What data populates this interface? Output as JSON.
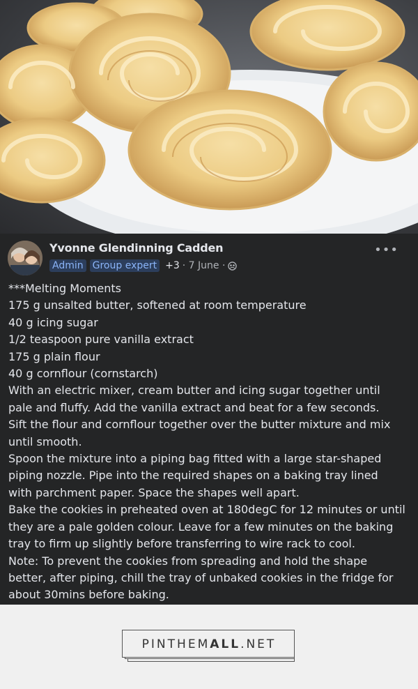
{
  "post": {
    "author": "Yvonne Glendinning Cadden",
    "badges": [
      "Admin",
      "Group expert"
    ],
    "extra_badges": "+3",
    "date": "· 7 June ·",
    "more_label": "•••",
    "icons": {
      "privacy": "group-globe-icon",
      "more": "more-options-icon"
    },
    "lines": [
      "***Melting Moments",
      "175 g unsalted butter, softened at room temperature",
      "40 g icing sugar",
      "1/2 teaspoon pure vanilla extract",
      "175 g plain flour",
      "40 g cornflour (cornstarch)",
      "With an electric mixer, cream butter and icing sugar together until",
      "pale and fluffy. Add the vanilla extract and beat for a few seconds.",
      "Sift the flour and cornflour together over the butter mixture and mix",
      "until smooth.",
      "Spoon the mixture into a piping bag fitted with a large star-shaped",
      "piping nozzle. Pipe into the required shapes on a baking tray lined",
      "with parchment paper. Space the shapes well apart.",
      "Bake the cookies in preheated oven at 180degC for 12 minutes or until",
      "they are a pale golden colour. Leave for a few minutes on the baking",
      "tray to firm up slightly before transferring to wire rack to cool.",
      "Note: To prevent the cookies from spreading and hold the shape",
      "better, after piping, chill the tray of unbaked cookies in the fridge for",
      "about 30mins before baking."
    ]
  },
  "watermark": {
    "part1": "PINTHEM",
    "part2": "ALL",
    "part3": ".NET"
  },
  "colors": {
    "post_bg": "#242526",
    "badge_bg": "#2c3e5c",
    "badge_text": "#8ab4f8",
    "page_bg": "#f0f0f0"
  }
}
